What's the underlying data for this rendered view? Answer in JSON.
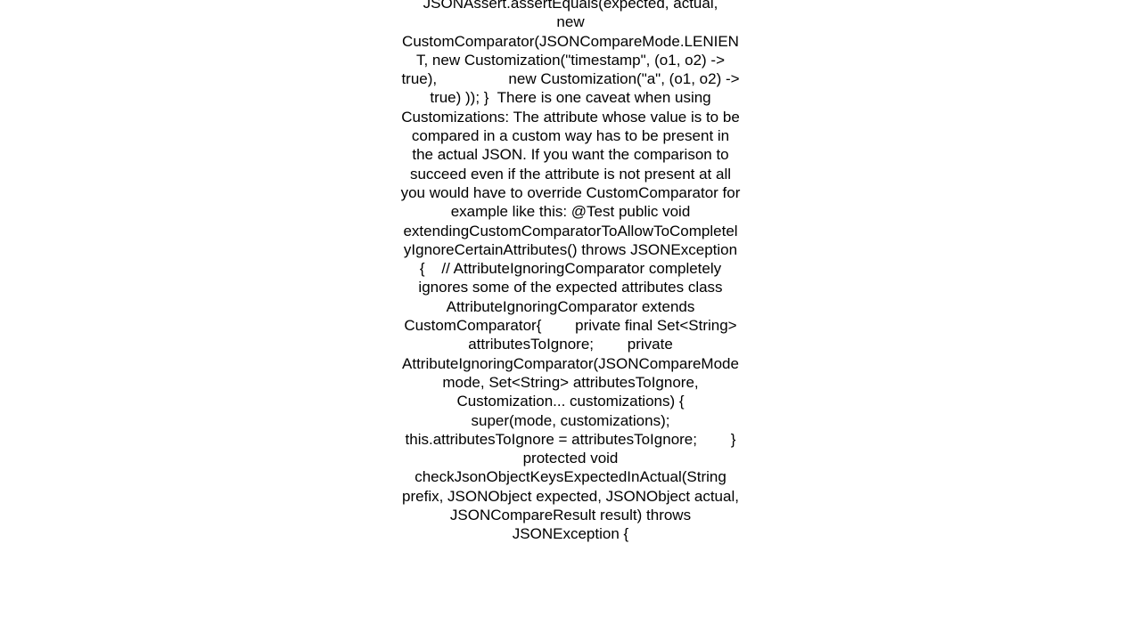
{
  "page": {
    "background_color": "#ffffff",
    "text_color": "#000000",
    "type": "plain-text-code-snippet",
    "clipped_top": true,
    "clipped_bottom": true
  },
  "content": {
    "full_text": "JSONAssert.assertEquals(expected, actual,         new CustomComparator(JSONCompareMode.LENIENT, new Customization(\"timestamp\", (o1, o2) -> true),                 new Customization(\"a\", (o1, o2) -> true) )); }  There is one caveat when using Customizations: The attribute whose value is to be compared in a custom way has to be present in the actual JSON. If you want the comparison to succeed even if the attribute is not present at all you would have to override CustomComparator for example like this: @Test public void extendingCustomComparatorToAllowToCompletelyIgnoreCertainAttributes() throws JSONException {    // AttributeIgnoringComparator completely ignores some of the expected attributes class AttributeIgnoringComparator extends CustomComparator{        private final Set<String> attributesToIgnore;        private AttributeIgnoringComparator(JSONCompareMode mode, Set<String> attributesToIgnore, Customization... customizations) {            super(mode, customizations);            this.attributesToIgnore = attributesToIgnore;        }        protected void checkJsonObjectKeysExpectedInActual(String prefix, JSONObject expected, JSONObject actual, JSONCompareResult result) throws JSONException {",
    "visible_lines": [
      "actual,          new CustomComparator",
      "(JSONCompareMode.LENIENT,",
      "new Customization(\"timestamp\", (o1, o2)",
      "-> true),                 new",
      "Customization(\"a\", (o1, o2) -> true)",
      ")); }  There is one caveat when using",
      "Customizations: The attribute whose",
      "value is to be compared in a custom way",
      "has to be present in the actual JSON. If",
      "you want the comparison to succeed even",
      "if the attribute is not present at all",
      "you would have to override",
      "CustomComparator for example like this:",
      "@Test public void extendingCustomCompara",
      "torToAllowToCompletelyIgnoreCertainAttri",
      "butes() throws JSONException {     //",
      "AttributeIgnoringComparator completely",
      "ignores some of the expected attributes",
      "class AttributeIgnoringComparator",
      "extends CustomComparator{",
      "private final Set<String>",
      "attributesToIgnore;         private Att",
      "ributeIgnoringComparator(JSONCompareMode",
      "mode, Set<String> attributesToIgnore,",
      "Customization... customizations) {",
      "super(mode, customizations);",
      "this.attributesToIgnore =",
      "attributesToIgnore;          }",
      "protected void checkJsonObjectKeysExpect",
      "edInActual(String prefix, JSONObject",
      "expected, JSONObject actual,",
      "JSONCompareResult result) throws",
      "JSONException {"
    ]
  }
}
